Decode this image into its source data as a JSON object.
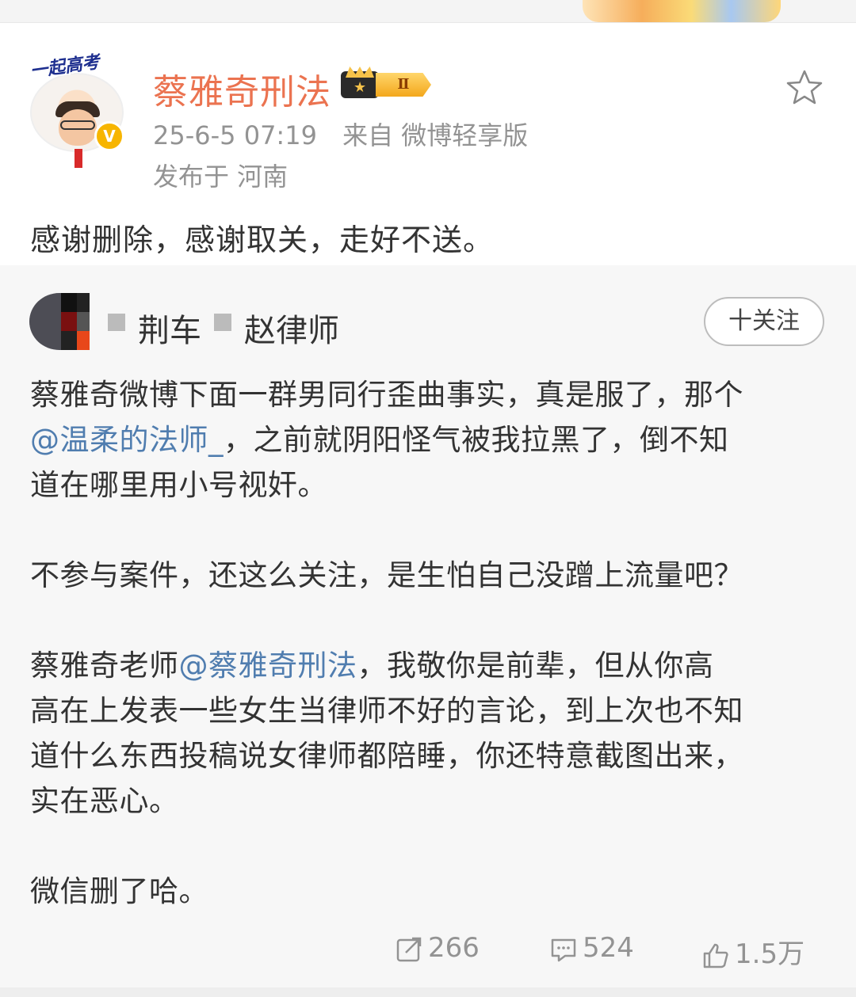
{
  "author": {
    "name": "蔡雅奇刑法",
    "avatar_badge_text": "一起高考",
    "verified_badge": "V",
    "member_level": "Ⅱ",
    "time": "25-6-5 07:19",
    "source": "来自 微博轻享版",
    "location": "发布于 河南"
  },
  "post": {
    "text": "感谢删除，感谢取关，走好不送。"
  },
  "repost": {
    "author_name_part1": "荆车",
    "author_name_part2": "赵律师",
    "follow_label": "十关注",
    "p1_l1": "蔡雅奇微博下面一群男同行歪曲事实，真是服了，那个",
    "p1_l2_mention": "@温柔的法师_",
    "p1_l2_rest": "，之前就阴阳怪气被我拉黑了，倒不知",
    "p1_l3": "道在哪里用小号视奸。",
    "p2": "不参与案件，还这么关注，是生怕自己没蹭上流量吧？",
    "p3_l1_a": "蔡雅奇老师",
    "p3_l1_mention": "@蔡雅奇刑法",
    "p3_l1_b": "，我敬你是前辈，但从你高",
    "p3_l2": "高在上发表一些女生当律师不好的言论，到上次也不知",
    "p3_l3": "道什么东西投稿说女律师都陪睡，你还特意截图出来，",
    "p3_l4": "实在恶心。",
    "p4": "微信删了哈。",
    "stats": {
      "reposts": "266",
      "comments": "524",
      "likes": "1.5万"
    }
  },
  "icons": {
    "favorite": "star-outline-icon",
    "repost": "share-icon",
    "comment": "comment-icon",
    "like": "thumb-up-icon"
  },
  "colors": {
    "name": "#eb7350",
    "mention": "#507daf",
    "meta": "#939393",
    "card_bg": "#f7f7f7"
  }
}
